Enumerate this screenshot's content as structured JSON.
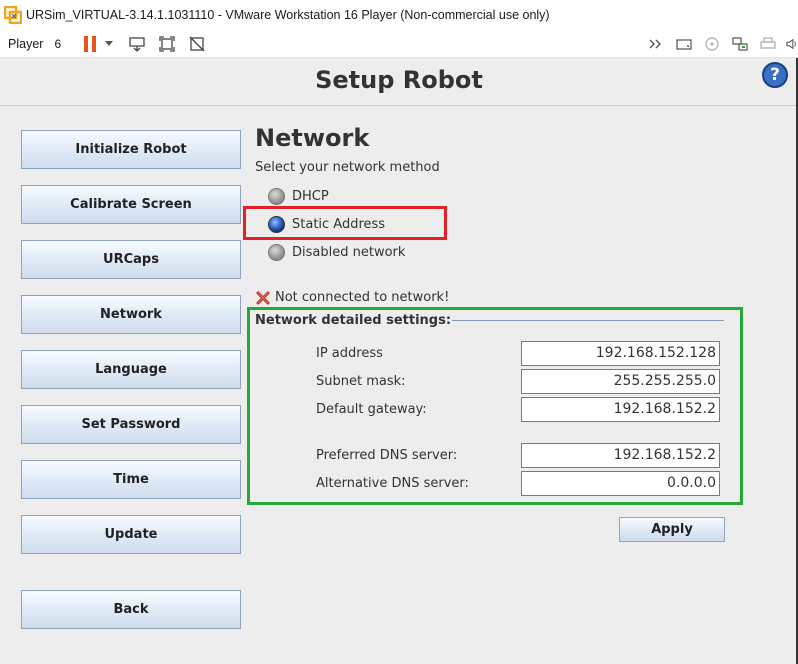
{
  "window": {
    "title": "URSim_VIRTUAL-3.14.1.1031110 - VMware Workstation 16 Player (Non-commercial use only)"
  },
  "toolbar": {
    "player_label": "Player",
    "vm_count": "6",
    "icons": [
      "pause-icon",
      "dropdown-arrow-icon",
      "send-ctrl-alt-del-icon",
      "fullscreen-icon",
      "unity-icon",
      "more-arrows-icon",
      "hard-disk-icon",
      "cd-icon",
      "network-adapter-icon",
      "printer-icon",
      "sound-icon"
    ]
  },
  "page": {
    "title": "Setup Robot",
    "help_label": "?"
  },
  "sidebar": {
    "items": [
      {
        "label": "Initialize Robot"
      },
      {
        "label": "Calibrate Screen"
      },
      {
        "label": "URCaps"
      },
      {
        "label": "Network"
      },
      {
        "label": "Language"
      },
      {
        "label": "Set Password"
      },
      {
        "label": "Time"
      },
      {
        "label": "Update"
      },
      {
        "label": "Back"
      }
    ]
  },
  "network": {
    "title": "Network",
    "subtitle": "Select your network method",
    "options": [
      {
        "label": "DHCP",
        "selected": false
      },
      {
        "label": "Static Address",
        "selected": true
      },
      {
        "label": "Disabled network",
        "selected": false
      }
    ],
    "status": "Not connected to network!",
    "settings_title": "Network detailed settings:",
    "fields": [
      {
        "label": "IP address",
        "value": "192.168.152.128"
      },
      {
        "label": "Subnet mask:",
        "value": "255.255.255.0"
      },
      {
        "label": "Default gateway:",
        "value": "192.168.152.2"
      },
      {
        "label": "Preferred DNS server:",
        "value": "192.168.152.2"
      },
      {
        "label": "Alternative DNS server:",
        "value": "0.0.0.0"
      }
    ],
    "apply_label": "Apply"
  },
  "colors": {
    "highlight_red": "#e0202a",
    "highlight_green": "#26a838",
    "pause_orange": "#e8541c"
  }
}
